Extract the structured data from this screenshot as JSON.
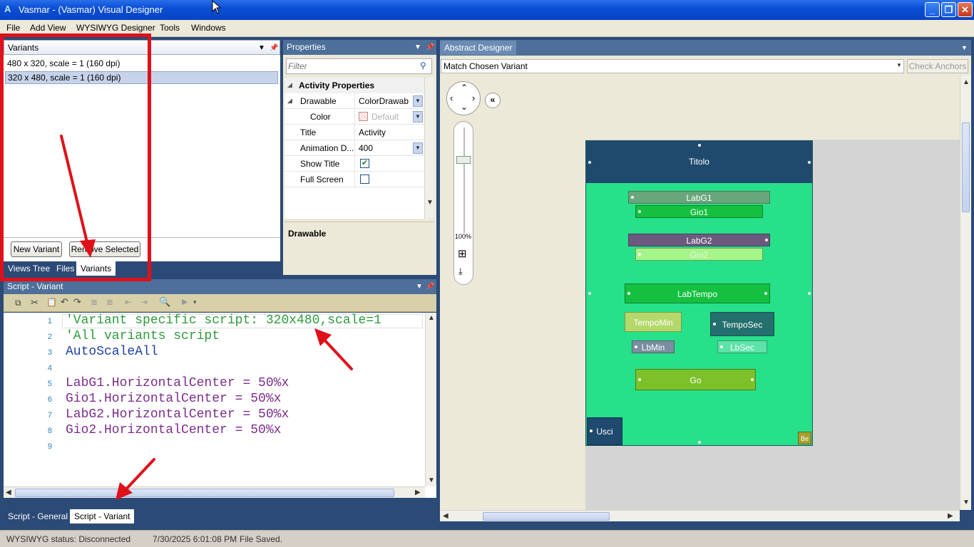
{
  "window": {
    "title": "Vasmar - (Vasmar) Visual Designer",
    "app_icon": "A",
    "minimize": "_",
    "maximize": "❐",
    "close": "✕"
  },
  "menu": [
    "File",
    "Add View",
    "WYSIWYG Designer",
    "Tools",
    "Windows"
  ],
  "variants_panel": {
    "title": "Variants",
    "items": [
      "480 x 320, scale = 1 (160 dpi)",
      "320 x 480, scale = 1 (160 dpi)"
    ],
    "selected_index": 1,
    "new_button": "New Variant",
    "remove_button": "Remove Selected",
    "tabs": [
      "Views Tree",
      "Files",
      "Variants"
    ],
    "active_tab": "Variants"
  },
  "properties_panel": {
    "title": "Properties",
    "filter_placeholder": "Filter",
    "section": "Activity Properties",
    "rows": [
      {
        "name": "Drawable",
        "value": "ColorDrawabl"
      },
      {
        "name": "Color",
        "value": "Default"
      },
      {
        "name": "Title",
        "value": "Activity"
      },
      {
        "name": "Animation D...",
        "value": "400"
      },
      {
        "name": "Show Title",
        "value": "checked"
      },
      {
        "name": "Full Screen",
        "value": "unchecked"
      }
    ],
    "description_title": "Drawable"
  },
  "script_panel": {
    "title": "Script - Variant",
    "lines": [
      "'Variant specific script: 320x480,scale=1",
      "'All variants script",
      "AutoScaleAll",
      "",
      "LabG1.HorizontalCenter = 50%x",
      "Gio1.HorizontalCenter = 50%x",
      "LabG2.HorizontalCenter = 50%x",
      "Gio2.HorizontalCenter = 50%x",
      ""
    ],
    "tabs": [
      "Script - General",
      "Script - Variant"
    ],
    "active_tab": "Script - Variant"
  },
  "designer_panel": {
    "title": "Abstract Designer",
    "variant_dropdown": "Match Chosen Variant",
    "check_anchors": "Check Anchors",
    "zoom_label": "100%",
    "widgets": {
      "titolo": "Titolo",
      "labg1": "LabG1",
      "gio1": "Gio1",
      "labg2": "LabG2",
      "gio2": "Gio2",
      "labtempo": "LabTempo",
      "tempomin": "TempoMin",
      "temposec": "TempoSec",
      "lbmin": "LbMin",
      "lbsec": "LbSec",
      "go": "Go",
      "usci": "Usci",
      "be": "Be"
    }
  },
  "status_bar": {
    "wysiwyg": "WYSIWYG status: Disconnected",
    "timestamp": "7/30/2025 6:01:08 PM",
    "message": "File Saved."
  },
  "colors": {
    "title_blue": "#0a4fd6",
    "ide_background": "#2b4a76",
    "annotation_red": "#e0101a",
    "activity_bg": "#26e08a",
    "titolo_bg": "#1f4a6e",
    "labg1_bg": "#6aa67c",
    "labg2_bg": "#6b5a7e",
    "green_button": "#15c040",
    "tempomin_bg": "#b4d86a",
    "temposec_bg": "#23706e",
    "go_bg": "#7cc12a"
  }
}
